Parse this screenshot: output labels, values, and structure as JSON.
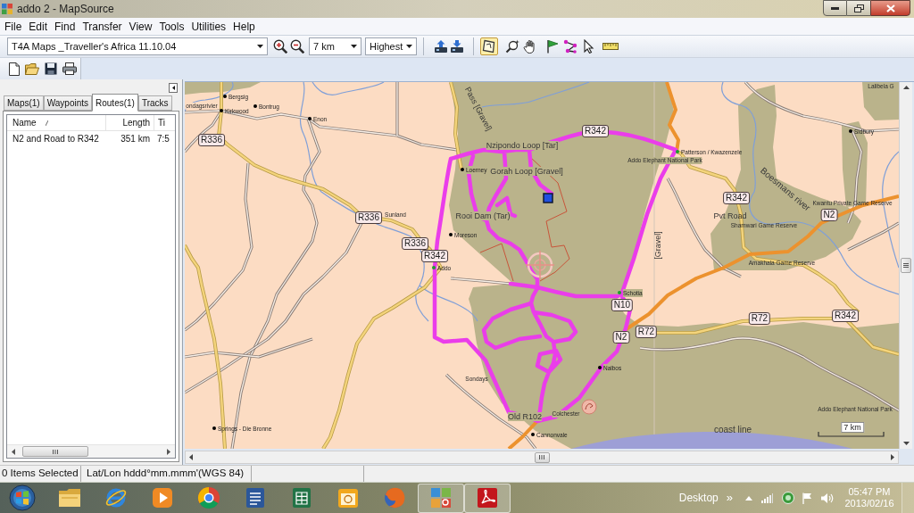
{
  "window": {
    "title": "addo 2 - MapSource"
  },
  "menu": [
    "File",
    "Edit",
    "Find",
    "Transfer",
    "View",
    "Tools",
    "Utilities",
    "Help"
  ],
  "toolbar": {
    "map_product": "T4A Maps _Traveller's Africa 11.10.04",
    "zoom_scale": "7 km",
    "detail": "Highest",
    "tools": [
      {
        "kind": "map",
        "selected": true
      },
      {
        "kind": "zoom",
        "selected": false
      },
      {
        "kind": "pan",
        "selected": false
      },
      {
        "kind": "waypoint",
        "selected": false
      },
      {
        "kind": "route",
        "selected": false
      },
      {
        "kind": "select",
        "selected": false
      },
      {
        "kind": "measure",
        "selected": false
      }
    ]
  },
  "sidebar": {
    "tabs": [
      {
        "label": "Maps(1)",
        "selected": false
      },
      {
        "label": "Waypoints",
        "selected": false
      },
      {
        "label": "Routes(1)",
        "selected": true
      },
      {
        "label": "Tracks",
        "selected": false
      }
    ],
    "columns": [
      "Name",
      "Length",
      "Ti"
    ],
    "rows": [
      [
        "N2 and Road to R342",
        "351 km",
        "7:5"
      ]
    ]
  },
  "map": {
    "labels": [
      {
        "text": "Lalibela G",
        "kind": "place"
      },
      {
        "text": "Bergsig",
        "kind": "town",
        "color": "#000000"
      },
      {
        "text": "ondagsrivier",
        "kind": "place"
      },
      {
        "text": "Kirkwood",
        "kind": "town",
        "color": "#000000"
      },
      {
        "text": "Bontrug",
        "kind": "town",
        "color": "#000000"
      },
      {
        "text": "Pass [Gravel]",
        "kind": "road"
      },
      {
        "text": "Enon",
        "kind": "town",
        "color": "#000000"
      },
      {
        "text": "R342",
        "kind": "shield"
      },
      {
        "text": "Sidbury",
        "kind": "town",
        "color": "#000000"
      },
      {
        "text": "R336",
        "kind": "shield"
      },
      {
        "text": "Nzipondo Loop [Tar]",
        "kind": "road"
      },
      {
        "text": "Patterson / Kwazenzele",
        "kind": "town",
        "color": "#1e9e2e"
      },
      {
        "text": "Addo Elephant National Park",
        "kind": "place"
      },
      {
        "text": "Loerney",
        "kind": "town",
        "color": "#000000"
      },
      {
        "text": "Gorah Loop [Gravel]",
        "kind": "road"
      },
      {
        "text": "Boesmans river",
        "kind": "water"
      },
      {
        "text": "R342",
        "kind": "shield"
      },
      {
        "text": "Kwantu Private Game Reserve",
        "kind": "place"
      },
      {
        "text": "R336",
        "kind": "shield"
      },
      {
        "text": "Sunland",
        "kind": "place"
      },
      {
        "text": "Rooi Dam (Tar)",
        "kind": "road"
      },
      {
        "text": "Pvt Road",
        "kind": "road"
      },
      {
        "text": "N2",
        "kind": "shield"
      },
      {
        "text": "Shamwari Game Reserve",
        "kind": "place"
      },
      {
        "text": "Moreson",
        "kind": "town",
        "color": "#000000"
      },
      {
        "text": "R336",
        "kind": "shield"
      },
      {
        "text": "[Gravel]",
        "kind": "road"
      },
      {
        "text": "R342",
        "kind": "shield"
      },
      {
        "text": "Addo",
        "kind": "town",
        "color": "#1e9e2e"
      },
      {
        "text": "Amakhala Game Reserve",
        "kind": "place"
      },
      {
        "text": "Schotia",
        "kind": "town",
        "color": "#1e9e2e"
      },
      {
        "text": "N10",
        "kind": "shield"
      },
      {
        "text": "R72",
        "kind": "shield"
      },
      {
        "text": "R342",
        "kind": "shield"
      },
      {
        "text": "N2",
        "kind": "shield"
      },
      {
        "text": "R72",
        "kind": "shield"
      },
      {
        "text": "Nalbos",
        "kind": "town",
        "color": "#000000"
      },
      {
        "text": "Sondays",
        "kind": "place"
      },
      {
        "text": "Old R102",
        "kind": "road"
      },
      {
        "text": "Colchester",
        "kind": "place"
      },
      {
        "text": "Addo Elephant National Park",
        "kind": "place"
      },
      {
        "text": "Springs - Die Bronne",
        "kind": "town",
        "color": "#000000"
      },
      {
        "text": "Cannonvale",
        "kind": "town",
        "color": "#000000"
      },
      {
        "text": "coast line",
        "kind": "water"
      }
    ],
    "scale": "7 km"
  },
  "status_bar": [
    "0 Items Selected",
    "Lat/Lon hddd°mm.mmm'(WGS 84)"
  ],
  "taskbar": {
    "apps": [
      {
        "kind": "folder",
        "running": false
      },
      {
        "kind": "e-browser",
        "running": false
      },
      {
        "kind": "player",
        "running": false
      },
      {
        "kind": "circle-browser",
        "running": false
      },
      {
        "kind": "word-processor",
        "running": false
      },
      {
        "kind": "spreadsheet",
        "running": false
      },
      {
        "kind": "calendar",
        "running": false
      },
      {
        "kind": "fox-browser",
        "running": false
      },
      {
        "kind": "map-app",
        "running": true
      },
      {
        "kind": "pdf-reader",
        "running": true
      }
    ],
    "desktop_label": "Desktop",
    "overflow": "»",
    "time": "05:47 PM",
    "date": "2013/02/16"
  }
}
